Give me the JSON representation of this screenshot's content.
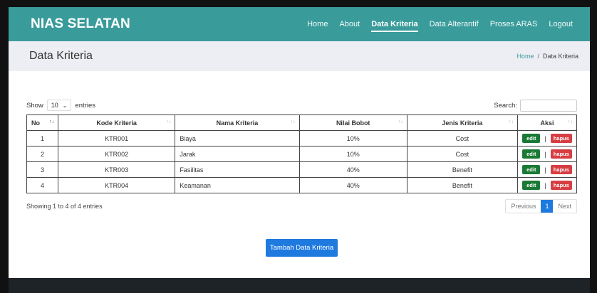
{
  "nav": {
    "brand": "NIAS SELATAN",
    "items": [
      {
        "label": "Home"
      },
      {
        "label": "About"
      },
      {
        "label": "Data Kriteria"
      },
      {
        "label": "Data Alterantif"
      },
      {
        "label": "Proses ARAS"
      },
      {
        "label": "Logout"
      }
    ],
    "active_index": 2
  },
  "header": {
    "title": "Data Kriteria",
    "breadcrumb_home": "Home",
    "breadcrumb_separator": "/",
    "breadcrumb_current": "Data Kriteria"
  },
  "controls": {
    "show_label": "Show",
    "entries_value": "10",
    "entries_label": "entries",
    "search_label": "Search:",
    "search_value": ""
  },
  "table": {
    "columns": [
      "No",
      "Kode Kriteria",
      "Nama Kriteria",
      "Nilai Bobot",
      "Jenis Kriteria",
      "Aksi"
    ],
    "rows": [
      {
        "no": "1",
        "kode": "KTR001",
        "nama": "Biaya",
        "bobot": "10%",
        "jenis": "Cost"
      },
      {
        "no": "2",
        "kode": "KTR002",
        "nama": "Jarak",
        "bobot": "10%",
        "jenis": "Cost"
      },
      {
        "no": "3",
        "kode": "KTR003",
        "nama": "Fasilitas",
        "bobot": "40%",
        "jenis": "Benefit"
      },
      {
        "no": "4",
        "kode": "KTR004",
        "nama": "Keamanan",
        "bobot": "40%",
        "jenis": "Benefit"
      }
    ],
    "edit_label": "edit",
    "separator": "|",
    "delete_label": "hapus"
  },
  "footer": {
    "info": "Showing 1 to 4 of 4 entries",
    "prev_label": "Previous",
    "current_page": "1",
    "next_label": "Next"
  },
  "add_button_label": "Tambah Data Kriteria",
  "colors": {
    "navbar": "#3a9b9b",
    "primary": "#1f7ae0",
    "edit": "#1a7a35",
    "delete": "#d63e43"
  }
}
